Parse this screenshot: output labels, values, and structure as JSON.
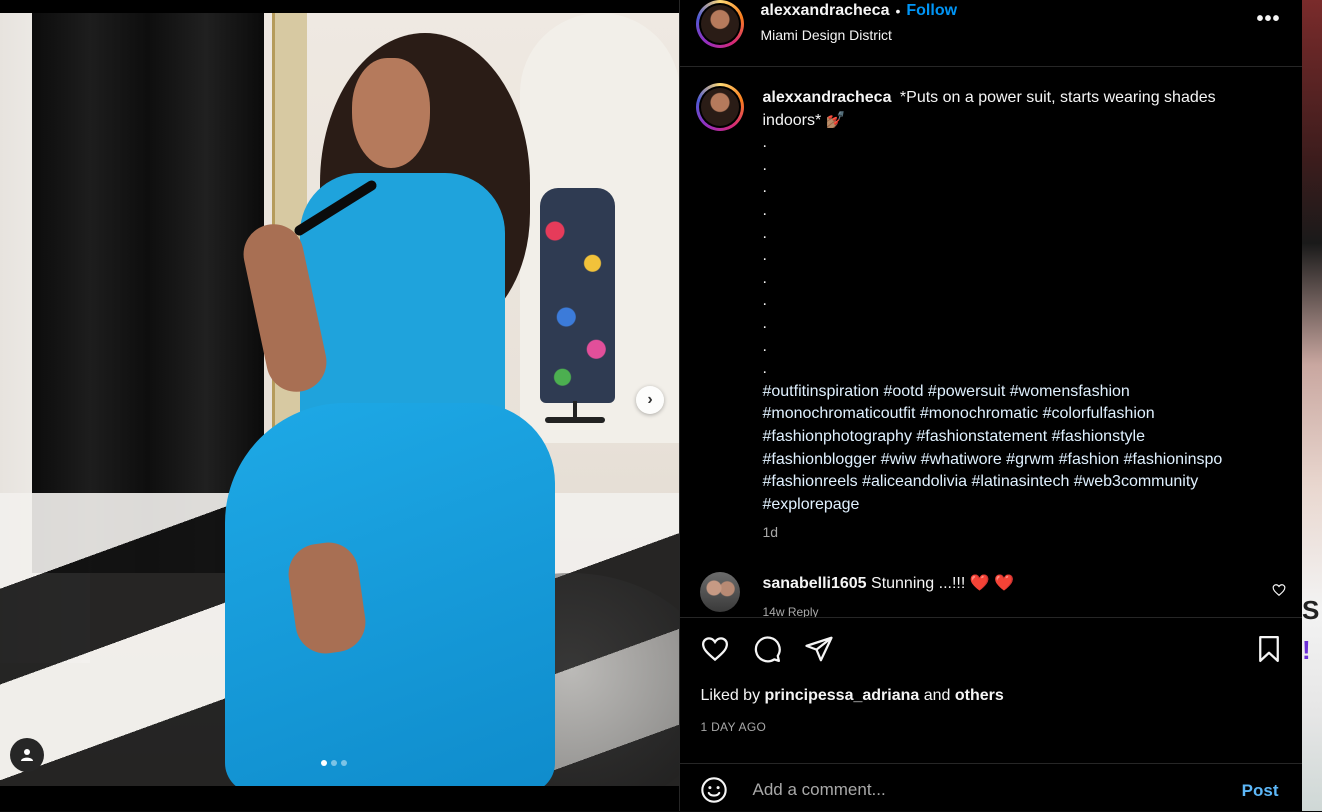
{
  "post": {
    "author": "alexxandracheca",
    "separator": "•",
    "follow_label": "Follow",
    "location": "Miami Design District",
    "more_label": "•••",
    "caption_text": "*Puts on a power suit, starts wearing shades indoors* 💅🏽",
    "caption_dots": ".\n.\n.\n.\n.\n.\n.\n.\n.\n.\n.",
    "hashtags": "#outfitinspiration #ootd #powersuit #womensfashion #monochromaticoutfit #monochromatic #colorfulfashion #fashionphotography #fashionstatement #fashionstyle #fashionblogger #wiw #whatiwore #grwm #fashion #fashioninspo #fashionreels #aliceandolivia #latinasintech #web3community #explorepage",
    "time_ago": "1d"
  },
  "comment": {
    "user": "sanabelli1605",
    "text": "Stunning ...!!! ❤️ ❤️",
    "meta": "14w  Reply"
  },
  "carousel": {
    "next_label": "›",
    "dots": 3,
    "active_dot": 0
  },
  "actions": {
    "liked_by_prefix": "Liked by",
    "liked_by_user": "principessa_adriana",
    "liked_by_and": "and",
    "liked_by_others": "others",
    "date": "1 DAY AGO"
  },
  "comment_box": {
    "placeholder": "Add a comment...",
    "post_label": "Post"
  },
  "background_strip": {
    "s": "S",
    "bang": "!"
  },
  "colors": {
    "follow": "#0095f6",
    "muted": "#a8a8a8",
    "post_button": "#5db7f7",
    "heart": "#ed4956"
  }
}
